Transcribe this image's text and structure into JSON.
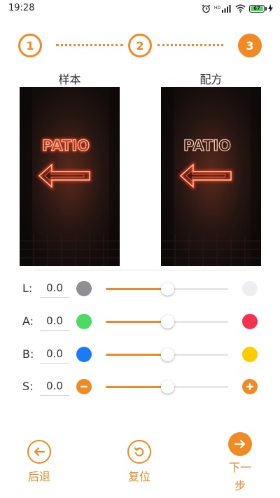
{
  "status_bar": {
    "time": "19:28",
    "network_label": "HD",
    "battery_level": "67"
  },
  "stepper": {
    "steps": [
      {
        "number": "1",
        "state": "done"
      },
      {
        "number": "2",
        "state": "done"
      },
      {
        "number": "3",
        "state": "current"
      }
    ]
  },
  "images": {
    "sample_label": "样本",
    "formula_label": "配方",
    "neon_text": "PATIO"
  },
  "sliders": [
    {
      "label": "L:",
      "value": "0.0",
      "left_icon": "gray-circle",
      "right_icon": "light-gray-circle",
      "left_color": "#8e8e93",
      "right_color": "#eeeef2",
      "position": 0.5
    },
    {
      "label": "A:",
      "value": "0.0",
      "left_icon": "green-circle",
      "right_icon": "red-circle",
      "left_color": "#4cd964",
      "right_color": "#f2334f",
      "position": 0.5
    },
    {
      "label": "B:",
      "value": "0.0",
      "left_icon": "blue-circle",
      "right_icon": "yellow-circle",
      "left_color": "#1a7cf5",
      "right_color": "#ffcc00",
      "position": 0.5
    },
    {
      "label": "S:",
      "value": "0.0",
      "left_icon": "minus-icon",
      "right_icon": "plus-icon",
      "left_color": "#f08a24",
      "right_color": "#f08a24",
      "position": 0.5
    }
  ],
  "bottom_nav": {
    "back_label": "后退",
    "reset_label": "复位",
    "next_label_line1": "下一",
    "next_label_line2": "步"
  },
  "colors": {
    "accent": "#f08a24"
  }
}
